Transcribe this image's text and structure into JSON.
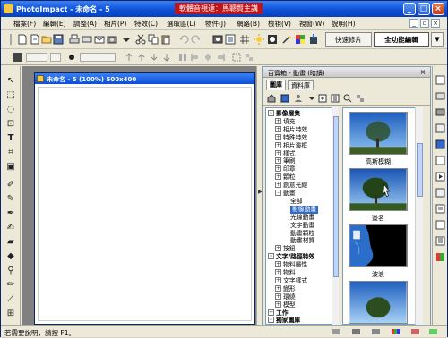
{
  "window": {
    "title": "PhotoImpact - 未命名 - 5",
    "banner": "軟體音視達：馬聰賢主講"
  },
  "menu": [
    "檔案(F)",
    "編輯(E)",
    "調整(A)",
    "相片(P)",
    "特效(C)",
    "選取區(L)",
    "物件(J)",
    "網路(B)",
    "檢視(V)",
    "視窗(W)",
    "說明(H)"
  ],
  "modes": {
    "quick": "快速修片",
    "full": "全功能編輯"
  },
  "document": {
    "title": "未命名 - 5 (100%) 500x400"
  },
  "panel": {
    "title": "百寶箱 - 動畫 (暗讀)",
    "tabs": [
      "圖庫",
      "資料庫"
    ],
    "tree": [
      {
        "label": "影像層集",
        "bold": true,
        "exp": "-"
      },
      {
        "label": "填充",
        "exp": "+"
      },
      {
        "label": "相片特效",
        "exp": "+"
      },
      {
        "label": "特殊特效",
        "exp": "+"
      },
      {
        "label": "相片邊框",
        "exp": "+"
      },
      {
        "label": "樣式",
        "exp": "+"
      },
      {
        "label": "筆刷",
        "exp": "+"
      },
      {
        "label": "印章",
        "exp": "+"
      },
      {
        "label": "顆粒",
        "exp": "+"
      },
      {
        "label": "創意光線",
        "exp": "+"
      },
      {
        "label": "動畫",
        "exp": "-"
      },
      {
        "label": "全部",
        "exp": ""
      },
      {
        "label": "影像動畫",
        "exp": "",
        "selected": true
      },
      {
        "label": "光線動畫",
        "exp": ""
      },
      {
        "label": "文字動畫",
        "exp": ""
      },
      {
        "label": "動畫顆粒",
        "exp": ""
      },
      {
        "label": "動畫材質",
        "exp": ""
      },
      {
        "label": "按鈕",
        "exp": "+"
      },
      {
        "label": "文字/路徑特效",
        "bold": true,
        "exp": "-"
      },
      {
        "label": "物料屬性",
        "exp": "+"
      },
      {
        "label": "物料",
        "exp": "+"
      },
      {
        "label": "文字樣式",
        "exp": "+"
      },
      {
        "label": "變形",
        "exp": "+"
      },
      {
        "label": "環繞",
        "exp": "+"
      },
      {
        "label": "模型",
        "exp": "+"
      },
      {
        "label": "工作",
        "bold": true,
        "exp": "+"
      },
      {
        "label": "獨家圖庫",
        "bold": true,
        "exp": "-"
      }
    ],
    "thumbnails": [
      {
        "label": "高斯模糊"
      },
      {
        "label": "簽名"
      },
      {
        "label": "波浪"
      },
      {
        "label": ""
      }
    ]
  },
  "status": {
    "text": "若需要說明，請按 F1。"
  },
  "colors": {
    "titlebar": "#0a4fd6",
    "banner": "#c0141a",
    "selection": "#316ac5",
    "workspace": "#808080"
  }
}
